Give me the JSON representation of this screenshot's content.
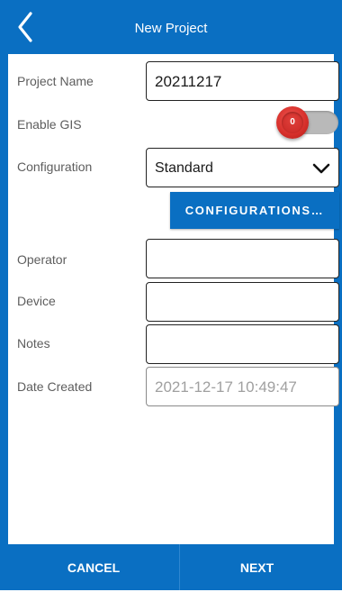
{
  "header": {
    "back_icon": "back-arrow-icon",
    "title": "New Project"
  },
  "form": {
    "project_name": {
      "label": "Project Name",
      "value": "20211217"
    },
    "enable_gis": {
      "label": "Enable GIS",
      "toggle_text": "0",
      "enabled": false,
      "knob_color": "#d8312c"
    },
    "configuration": {
      "label": "Configuration",
      "value": "Standard",
      "icon": "chevron-down-icon"
    },
    "configurations_button": "CONFIGURATIONS…",
    "operator": {
      "label": "Operator",
      "value": ""
    },
    "device": {
      "label": "Device",
      "value": ""
    },
    "notes": {
      "label": "Notes",
      "value": ""
    },
    "date_created": {
      "label": "Date Created",
      "value": "2021-12-17 10:49:47"
    }
  },
  "footer": {
    "cancel_label": "CANCEL",
    "next_label": "NEXT"
  },
  "colors": {
    "accent": "#0a6fc2",
    "toggle_off_track": "#b9b9b9"
  }
}
